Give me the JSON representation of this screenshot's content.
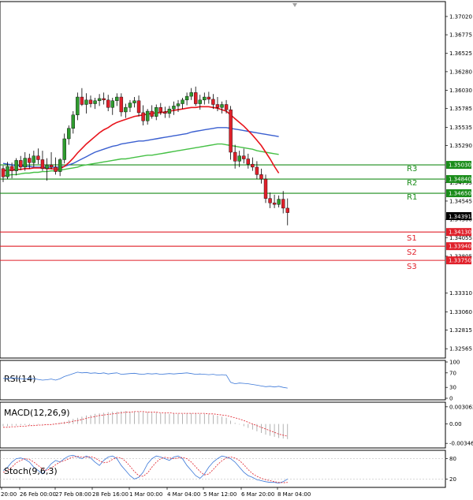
{
  "chart_data": {
    "type": "candlestick",
    "x_ticks": [
      "20:00",
      "26 Feb 00:00",
      "27 Feb 08:00",
      "28 Feb 16:00",
      "1 Mar 00:00",
      "4 Mar 04:00",
      "5 Mar 12:00",
      "6 Mar 20:00",
      "8 Mar 04:00"
    ],
    "y_ticks": [
      "1.37020",
      "1.36775",
      "1.36525",
      "1.36280",
      "1.36030",
      "1.35785",
      "1.35535",
      "1.35290",
      "1.34795",
      "1.34545",
      "1.34300",
      "1.34055",
      "1.33805",
      "1.33310",
      "1.33060",
      "1.32815",
      "1.32565"
    ],
    "ylim": [
      1.3244,
      1.3722
    ],
    "current_price": "1.34391",
    "colors": {
      "up": "#2e9b2e",
      "down": "#e0202a",
      "ma_fast": "#e8141c",
      "ma_mid": "#3a5fd0",
      "ma_slow": "#45c045",
      "resistance": "#1a8c1a",
      "support": "#e0202a"
    },
    "levels": [
      {
        "name": "R3",
        "tag": "1.35030",
        "value": 1.3503,
        "kind": "resistance"
      },
      {
        "name": "R2",
        "tag": "1.34840",
        "value": 1.3484,
        "kind": "resistance"
      },
      {
        "name": "R1",
        "tag": "1.34650",
        "value": 1.3465,
        "kind": "resistance"
      },
      {
        "name": "S1",
        "tag": "1.34130",
        "value": 1.3413,
        "kind": "support"
      },
      {
        "name": "S2",
        "tag": "1.33940",
        "value": 1.3394,
        "kind": "support"
      },
      {
        "name": "S3",
        "tag": "1.33750",
        "value": 1.3375,
        "kind": "support"
      }
    ],
    "candles": [
      [
        1.3498,
        1.3502,
        1.348,
        1.3487
      ],
      [
        1.3487,
        1.3507,
        1.3484,
        1.3501
      ],
      [
        1.3501,
        1.3506,
        1.3485,
        1.3495
      ],
      [
        1.3495,
        1.3512,
        1.3489,
        1.3509
      ],
      [
        1.3509,
        1.3515,
        1.3496,
        1.35
      ],
      [
        1.35,
        1.352,
        1.3495,
        1.3512
      ],
      [
        1.3512,
        1.3518,
        1.3498,
        1.3506
      ],
      [
        1.3506,
        1.3522,
        1.35,
        1.3515
      ],
      [
        1.3515,
        1.3525,
        1.3504,
        1.351
      ],
      [
        1.351,
        1.3522,
        1.3495,
        1.3498
      ],
      [
        1.3498,
        1.3512,
        1.3482,
        1.3503
      ],
      [
        1.3503,
        1.352,
        1.3497,
        1.35
      ],
      [
        1.35,
        1.3513,
        1.349,
        1.3494
      ],
      [
        1.3494,
        1.3512,
        1.3488,
        1.351
      ],
      [
        1.351,
        1.3545,
        1.3505,
        1.3538
      ],
      [
        1.3538,
        1.3556,
        1.353,
        1.3552
      ],
      [
        1.3552,
        1.3575,
        1.3545,
        1.357
      ],
      [
        1.357,
        1.36,
        1.3563,
        1.3594
      ],
      [
        1.3594,
        1.3606,
        1.3582,
        1.3584
      ],
      [
        1.3584,
        1.3599,
        1.3572,
        1.359
      ],
      [
        1.359,
        1.3596,
        1.358,
        1.3585
      ],
      [
        1.3585,
        1.3593,
        1.3578,
        1.3589
      ],
      [
        1.3589,
        1.3598,
        1.3582,
        1.3592
      ],
      [
        1.3592,
        1.36,
        1.3584,
        1.359
      ],
      [
        1.359,
        1.3597,
        1.3575,
        1.358
      ],
      [
        1.358,
        1.3593,
        1.357,
        1.3589
      ],
      [
        1.3589,
        1.3599,
        1.3582,
        1.3594
      ],
      [
        1.3594,
        1.3599,
        1.3568,
        1.3574
      ],
      [
        1.3574,
        1.3585,
        1.3566,
        1.358
      ],
      [
        1.358,
        1.359,
        1.3574,
        1.3586
      ],
      [
        1.3586,
        1.3594,
        1.358,
        1.3589
      ],
      [
        1.3589,
        1.3596,
        1.3568,
        1.3573
      ],
      [
        1.3573,
        1.3583,
        1.3556,
        1.3562
      ],
      [
        1.3562,
        1.3578,
        1.3557,
        1.3575
      ],
      [
        1.3575,
        1.3583,
        1.3565,
        1.3568
      ],
      [
        1.3568,
        1.3584,
        1.3563,
        1.358
      ],
      [
        1.358,
        1.3586,
        1.357,
        1.3574
      ],
      [
        1.3574,
        1.3581,
        1.3566,
        1.3572
      ],
      [
        1.3572,
        1.3582,
        1.3566,
        1.3578
      ],
      [
        1.3578,
        1.3588,
        1.357,
        1.3582
      ],
      [
        1.3582,
        1.359,
        1.3574,
        1.3585
      ],
      [
        1.3585,
        1.3593,
        1.3578,
        1.359
      ],
      [
        1.359,
        1.36,
        1.3583,
        1.3595
      ],
      [
        1.3595,
        1.3606,
        1.359,
        1.36
      ],
      [
        1.36,
        1.3608,
        1.3582,
        1.3585
      ],
      [
        1.3585,
        1.3597,
        1.3577,
        1.359
      ],
      [
        1.359,
        1.36,
        1.3584,
        1.3594
      ],
      [
        1.3594,
        1.3601,
        1.3585,
        1.3591
      ],
      [
        1.3591,
        1.3598,
        1.3578,
        1.3584
      ],
      [
        1.3584,
        1.3594,
        1.3575,
        1.358
      ],
      [
        1.358,
        1.3588,
        1.3572,
        1.3584
      ],
      [
        1.3584,
        1.359,
        1.3572,
        1.3577
      ],
      [
        1.3577,
        1.3582,
        1.351,
        1.352
      ],
      [
        1.352,
        1.353,
        1.3498,
        1.3508
      ],
      [
        1.3508,
        1.3522,
        1.35,
        1.3515
      ],
      [
        1.3515,
        1.3525,
        1.3505,
        1.3511
      ],
      [
        1.3511,
        1.3518,
        1.3498,
        1.3504
      ],
      [
        1.3504,
        1.3513,
        1.3495,
        1.35
      ],
      [
        1.35,
        1.3508,
        1.3484,
        1.349
      ],
      [
        1.349,
        1.3498,
        1.3478,
        1.3484
      ],
      [
        1.3484,
        1.349,
        1.3452,
        1.3458
      ],
      [
        1.3458,
        1.3466,
        1.3445,
        1.3452
      ],
      [
        1.3452,
        1.3463,
        1.3445,
        1.345
      ],
      [
        1.345,
        1.3462,
        1.3446,
        1.3457
      ],
      [
        1.3457,
        1.3468,
        1.3438,
        1.3445
      ],
      [
        1.3445,
        1.3458,
        1.3422,
        1.3439
      ]
    ],
    "ma_fast": [
      1.3495,
      1.3496,
      1.3496,
      1.3497,
      1.3497,
      1.3498,
      1.3498,
      1.3499,
      1.3499,
      1.3499,
      1.3498,
      1.3498,
      1.3497,
      1.3498,
      1.3501,
      1.3506,
      1.3512,
      1.3519,
      1.3525,
      1.3531,
      1.3536,
      1.3541,
      1.3546,
      1.355,
      1.3553,
      1.3557,
      1.356,
      1.3562,
      1.3564,
      1.3566,
      1.3568,
      1.3569,
      1.357,
      1.3571,
      1.3572,
      1.3573,
      1.3573,
      1.3574,
      1.3575,
      1.3576,
      1.3577,
      1.3578,
      1.3579,
      1.358,
      1.358,
      1.3581,
      1.3581,
      1.3581,
      1.358,
      1.3579,
      1.3577,
      1.3575,
      1.357,
      1.3565,
      1.356,
      1.3555,
      1.3549,
      1.3543,
      1.3536,
      1.3529,
      1.352,
      1.3511,
      1.3501,
      1.3492
    ],
    "ma_mid": [
      1.3505,
      1.3504,
      1.3503,
      1.3502,
      1.3502,
      1.3501,
      1.3501,
      1.35,
      1.35,
      1.35,
      1.35,
      1.35,
      1.35,
      1.35,
      1.3501,
      1.3503,
      1.3505,
      1.3508,
      1.3511,
      1.3514,
      1.3517,
      1.352,
      1.3522,
      1.3524,
      1.3526,
      1.3528,
      1.3529,
      1.3531,
      1.3532,
      1.3533,
      1.3534,
      1.3535,
      1.3535,
      1.3536,
      1.3537,
      1.3538,
      1.3539,
      1.354,
      1.3541,
      1.3542,
      1.3543,
      1.3544,
      1.3545,
      1.3547,
      1.3548,
      1.3549,
      1.355,
      1.3551,
      1.3552,
      1.3553,
      1.3553,
      1.3553,
      1.3552,
      1.3551,
      1.355,
      1.3549,
      1.3548,
      1.3547,
      1.3546,
      1.3545,
      1.3544,
      1.3543,
      1.3542,
      1.3541
    ],
    "ma_slow": [
      1.3488,
      1.3489,
      1.349,
      1.349,
      1.3491,
      1.3492,
      1.3492,
      1.3493,
      1.3493,
      1.3494,
      1.3494,
      1.3495,
      1.3495,
      1.3496,
      1.3497,
      1.3498,
      1.3499,
      1.35,
      1.3502,
      1.3503,
      1.3504,
      1.3505,
      1.3506,
      1.3507,
      1.3508,
      1.3509,
      1.351,
      1.3511,
      1.3511,
      1.3512,
      1.3513,
      1.3514,
      1.3515,
      1.3516,
      1.3516,
      1.3517,
      1.3518,
      1.3519,
      1.352,
      1.3521,
      1.3522,
      1.3523,
      1.3524,
      1.3525,
      1.3526,
      1.3527,
      1.3528,
      1.3529,
      1.353,
      1.3531,
      1.3531,
      1.353,
      1.3529,
      1.3528,
      1.3527,
      1.3526,
      1.3525,
      1.3524,
      1.3522,
      1.3521,
      1.352,
      1.3519,
      1.3518,
      1.3517
    ],
    "rsi": {
      "label": "RSI(14)",
      "ticks": [
        "100",
        "70",
        "30",
        "0"
      ],
      "ylim": [
        0,
        100
      ],
      "values": [
        55,
        54,
        56,
        55,
        54,
        53,
        55,
        54,
        52,
        50,
        51,
        53,
        50,
        54,
        60,
        64,
        68,
        72,
        70,
        71,
        69,
        70,
        68,
        70,
        67,
        69,
        70,
        66,
        67,
        68,
        69,
        67,
        66,
        68,
        67,
        68,
        66,
        67,
        68,
        67,
        68,
        69,
        70,
        68,
        66,
        67,
        66,
        65,
        66,
        64,
        65,
        64,
        44,
        40,
        42,
        41,
        40,
        38,
        36,
        34,
        32,
        33,
        31,
        33,
        30,
        28
      ]
    },
    "macd": {
      "label": "MACD(12,26,9)",
      "ticks": [
        "0.003062",
        "0.00",
        "-0.003463"
      ],
      "ylim": [
        -0.004,
        0.0036
      ],
      "hist": [
        -0.0004,
        -0.0004,
        -0.0003,
        -0.0003,
        -0.0002,
        -0.0002,
        -0.0002,
        -0.0001,
        -0.0001,
        -0.0001,
        0.0,
        0.0,
        0.0001,
        0.0002,
        0.0004,
        0.0007,
        0.0009,
        0.0011,
        0.0013,
        0.0015,
        0.0016,
        0.0018,
        0.0019,
        0.002,
        0.0021,
        0.0022,
        0.0022,
        0.0023,
        0.0023,
        0.0022,
        0.0022,
        0.0022,
        0.0021,
        0.0021,
        0.002,
        0.002,
        0.0019,
        0.0019,
        0.0018,
        0.0018,
        0.0018,
        0.0018,
        0.0019,
        0.0019,
        0.0019,
        0.0018,
        0.0018,
        0.0017,
        0.0016,
        0.0015,
        0.0013,
        0.0011,
        0.0006,
        0.0002,
        -0.0001,
        -0.0004,
        -0.0007,
        -0.001,
        -0.0013,
        -0.0016,
        -0.0019,
        -0.0021,
        -0.0023,
        -0.0025,
        -0.0026,
        -0.0027
      ],
      "signal": [
        -0.0006,
        -0.0006,
        -0.0005,
        -0.0005,
        -0.0004,
        -0.0004,
        -0.0003,
        -0.0003,
        -0.0002,
        -0.0002,
        -0.0001,
        -0.0001,
        0.0,
        0.0001,
        0.0002,
        0.0003,
        0.0005,
        0.0006,
        0.0008,
        0.001,
        0.0012,
        0.0013,
        0.0015,
        0.0016,
        0.0017,
        0.0018,
        0.0019,
        0.002,
        0.0021,
        0.0021,
        0.0022,
        0.0022,
        0.0022,
        0.0021,
        0.0021,
        0.0021,
        0.002,
        0.002,
        0.002,
        0.0019,
        0.0019,
        0.0019,
        0.0019,
        0.0019,
        0.0019,
        0.0019,
        0.0019,
        0.0018,
        0.0018,
        0.0017,
        0.0016,
        0.0015,
        0.0013,
        0.0011,
        0.0009,
        0.0006,
        0.0003,
        0.0,
        -0.0003,
        -0.0006,
        -0.0009,
        -0.0012,
        -0.0015,
        -0.0018,
        -0.002,
        -0.0022
      ]
    },
    "stoch": {
      "label": "Stoch(9,6,3)",
      "ticks": [
        "80",
        "20"
      ],
      "ylim": [
        0,
        100
      ],
      "main": [
        45,
        55,
        70,
        80,
        82,
        78,
        70,
        55,
        45,
        35,
        50,
        65,
        75,
        70,
        80,
        88,
        90,
        85,
        80,
        88,
        82,
        70,
        60,
        75,
        85,
        88,
        80,
        60,
        45,
        30,
        20,
        25,
        40,
        65,
        80,
        88,
        85,
        80,
        75,
        85,
        88,
        80,
        60,
        45,
        30,
        22,
        35,
        55,
        70,
        80,
        88,
        85,
        80,
        70,
        55,
        40,
        30,
        25,
        18,
        15,
        12,
        10,
        10,
        8,
        12,
        20
      ],
      "signal": [
        40,
        45,
        55,
        68,
        75,
        80,
        78,
        70,
        60,
        50,
        45,
        52,
        62,
        70,
        74,
        80,
        85,
        87,
        85,
        84,
        86,
        82,
        74,
        68,
        70,
        78,
        84,
        82,
        72,
        58,
        42,
        30,
        28,
        38,
        55,
        70,
        80,
        84,
        82,
        80,
        82,
        84,
        80,
        70,
        56,
        42,
        32,
        35,
        48,
        62,
        74,
        82,
        85,
        82,
        75,
        62,
        48,
        36,
        28,
        22,
        18,
        15,
        12,
        10,
        9,
        10
      ]
    }
  }
}
